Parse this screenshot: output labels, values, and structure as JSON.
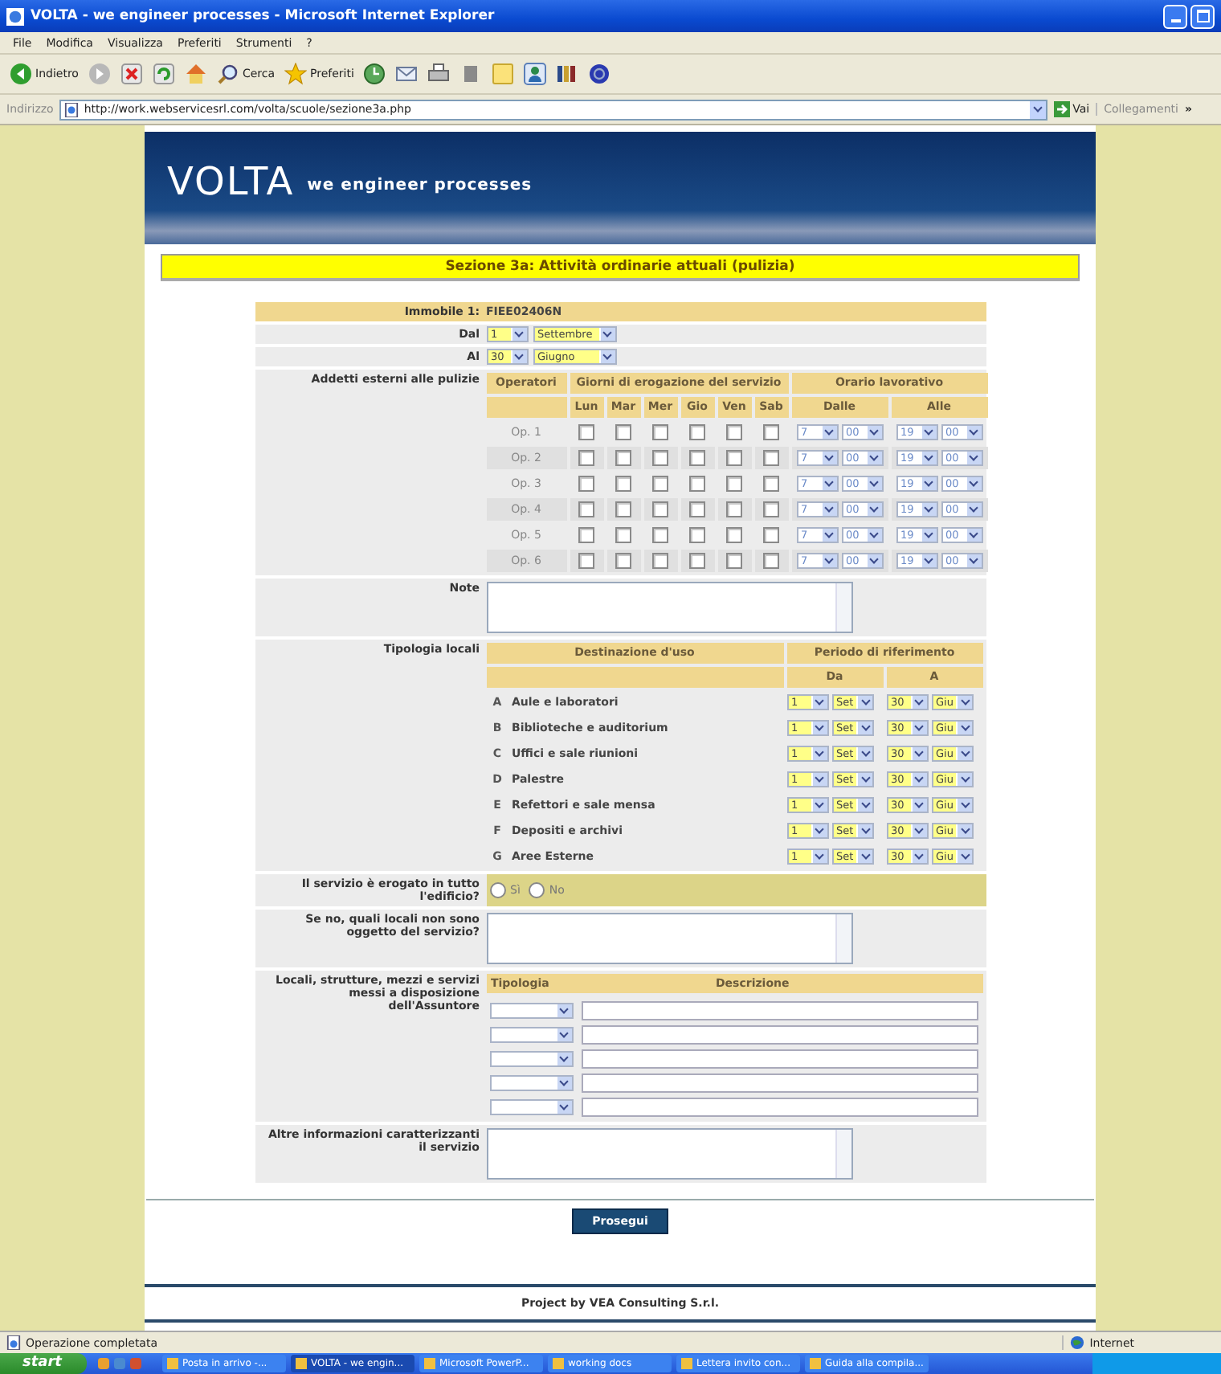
{
  "window": {
    "title": "VOLTA - we engineer processes - Microsoft Internet Explorer"
  },
  "menu": [
    "File",
    "Modifica",
    "Visualizza",
    "Preferiti",
    "Strumenti",
    "?"
  ],
  "toolbar": [
    {
      "kind": "back",
      "label": "Indietro"
    },
    {
      "kind": "forward"
    },
    {
      "kind": "stop"
    },
    {
      "kind": "refresh"
    },
    {
      "kind": "home"
    },
    {
      "kind": "search",
      "label": "Cerca"
    },
    {
      "kind": "favorites",
      "label": "Preferiti"
    },
    {
      "kind": "history"
    },
    {
      "kind": "mail"
    },
    {
      "kind": "print"
    },
    {
      "kind": "edit"
    },
    {
      "kind": "note"
    },
    {
      "kind": "messenger"
    },
    {
      "kind": "research"
    },
    {
      "kind": "logo"
    }
  ],
  "address": {
    "label": "Indirizzo",
    "url": "http://work.webservicesrl.com/volta/scuole/sezione3a.php",
    "go": "Vai",
    "links": "Collegamenti",
    "more": "»"
  },
  "banner": {
    "brand": "VOLTA",
    "tagline": "we engineer processes"
  },
  "section_title": "Sezione 3a: Attività ordinarie attuali (pulizia)",
  "immobile": {
    "label": "Immobile 1:",
    "value": "FIEE02406N"
  },
  "dal": {
    "label": "Dal",
    "day": "1",
    "month": "Settembre"
  },
  "al": {
    "label": "Al",
    "day": "30",
    "month": "Giugno"
  },
  "addetti": {
    "label": "Addetti esterni alle pulizie",
    "operators": "Operatori",
    "days_header": "Giorni di erogazione del servizio",
    "hours_header": "Orario lavorativo",
    "days": [
      "Lun",
      "Mar",
      "Mer",
      "Gio",
      "Ven",
      "Sab"
    ],
    "from": "Dalle",
    "to": "Alle",
    "rows": [
      {
        "name": "Op. 1",
        "checked": [
          false,
          false,
          false,
          false,
          false,
          false
        ],
        "from_h": "7",
        "from_m": "00",
        "to_h": "19",
        "to_m": "00"
      },
      {
        "name": "Op. 2",
        "checked": [
          false,
          false,
          false,
          false,
          false,
          false
        ],
        "from_h": "7",
        "from_m": "00",
        "to_h": "19",
        "to_m": "00"
      },
      {
        "name": "Op. 3",
        "checked": [
          false,
          false,
          false,
          false,
          false,
          false
        ],
        "from_h": "7",
        "from_m": "00",
        "to_h": "19",
        "to_m": "00"
      },
      {
        "name": "Op. 4",
        "checked": [
          false,
          false,
          false,
          false,
          false,
          false
        ],
        "from_h": "7",
        "from_m": "00",
        "to_h": "19",
        "to_m": "00"
      },
      {
        "name": "Op. 5",
        "checked": [
          false,
          false,
          false,
          false,
          false,
          false
        ],
        "from_h": "7",
        "from_m": "00",
        "to_h": "19",
        "to_m": "00"
      },
      {
        "name": "Op. 6",
        "checked": [
          false,
          false,
          false,
          false,
          false,
          false
        ],
        "from_h": "7",
        "from_m": "00",
        "to_h": "19",
        "to_m": "00"
      }
    ]
  },
  "note": {
    "label": "Note"
  },
  "locali": {
    "label": "Tipologia locali",
    "use_header": "Destinazione d'uso",
    "period_header": "Periodo di riferimento",
    "from": "Da",
    "to": "A",
    "rows": [
      {
        "letter": "A",
        "name": "Aule e laboratori",
        "from_day": "1",
        "from_month": "Set",
        "to_day": "30",
        "to_month": "Giu"
      },
      {
        "letter": "B",
        "name": "Biblioteche e auditorium",
        "from_day": "1",
        "from_month": "Set",
        "to_day": "30",
        "to_month": "Giu"
      },
      {
        "letter": "C",
        "name": "Uffici e sale riunioni",
        "from_day": "1",
        "from_month": "Set",
        "to_day": "30",
        "to_month": "Giu"
      },
      {
        "letter": "D",
        "name": "Palestre",
        "from_day": "1",
        "from_month": "Set",
        "to_day": "30",
        "to_month": "Giu"
      },
      {
        "letter": "E",
        "name": "Refettori e sale mensa",
        "from_day": "1",
        "from_month": "Set",
        "to_day": "30",
        "to_month": "Giu"
      },
      {
        "letter": "F",
        "name": "Depositi e archivi",
        "from_day": "1",
        "from_month": "Set",
        "to_day": "30",
        "to_month": "Giu"
      },
      {
        "letter": "G",
        "name": "Aree Esterne",
        "from_day": "1",
        "from_month": "Set",
        "to_day": "30",
        "to_month": "Giu"
      }
    ]
  },
  "servizio": {
    "label": "Il servizio è erogato in tutto l'edificio?",
    "options": [
      {
        "label": "Sì",
        "selected": false
      },
      {
        "label": "No",
        "selected": false
      }
    ]
  },
  "se_no": {
    "label": "Se no, quali locali non sono oggetto del servizio?"
  },
  "risorse": {
    "label": "Locali, strutture, mezzi e servizi messi a disposizione dell'Assuntore",
    "type_header": "Tipologia",
    "desc_header": "Descrizione",
    "rows": [
      {
        "kind": "entry"
      },
      {
        "kind": "entry"
      },
      {
        "kind": "entry"
      },
      {
        "kind": "entry"
      },
      {
        "kind": "entry"
      }
    ]
  },
  "altre": {
    "label": "Altre informazioni caratterizzanti il servizio"
  },
  "submit": "Prosegui",
  "footer": "Project by VEA Consulting S.r.l.",
  "status": {
    "text": "Operazione completata",
    "zone": "Internet"
  },
  "taskbar": {
    "start": "start",
    "items": [
      {
        "label": "Posta in arrivo -...",
        "selected": false
      },
      {
        "label": "VOLTA - we engin...",
        "selected": true
      },
      {
        "label": "Microsoft PowerP...",
        "selected": false
      },
      {
        "label": "working docs",
        "selected": false
      },
      {
        "label": "Lettera invito con...",
        "selected": false
      },
      {
        "label": "Guida alla compila...",
        "selected": false
      }
    ]
  }
}
